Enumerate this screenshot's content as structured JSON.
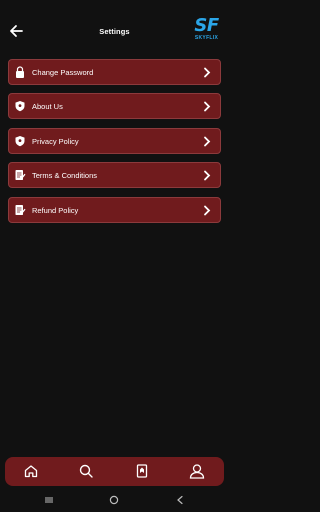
{
  "header": {
    "title": "Settings",
    "logo_letters": "SF",
    "logo_word": "SKYFLIX"
  },
  "menu": [
    {
      "label": "Change Password",
      "icon": "lock-icon"
    },
    {
      "label": "About Us",
      "icon": "shield-icon"
    },
    {
      "label": "Privacy Policy",
      "icon": "shield-icon"
    },
    {
      "label": "Terms & Conditions",
      "icon": "document-edit-icon"
    },
    {
      "label": "Refund Policy",
      "icon": "document-edit-icon"
    }
  ],
  "bottom_nav": [
    "home-icon",
    "search-icon",
    "bookmark-icon",
    "profile-icon"
  ],
  "colors": {
    "background": "#111111",
    "card": "#701b1d",
    "accent": "#2ba6e8"
  }
}
